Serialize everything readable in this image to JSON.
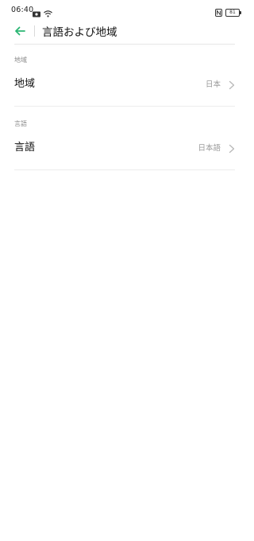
{
  "status_bar": {
    "time": "06:40",
    "battery": "81",
    "icons": [
      "screen-record-icon",
      "wifi-icon",
      "nfc-icon",
      "battery-icon"
    ]
  },
  "header": {
    "title": "言語および地域",
    "back_icon": "arrow-left-icon",
    "accent_color": "#2bb673"
  },
  "sections": [
    {
      "label": "地域",
      "row": {
        "label": "地域",
        "value": "日本"
      }
    },
    {
      "label": "言語",
      "row": {
        "label": "言語",
        "value": "日本語"
      }
    }
  ]
}
